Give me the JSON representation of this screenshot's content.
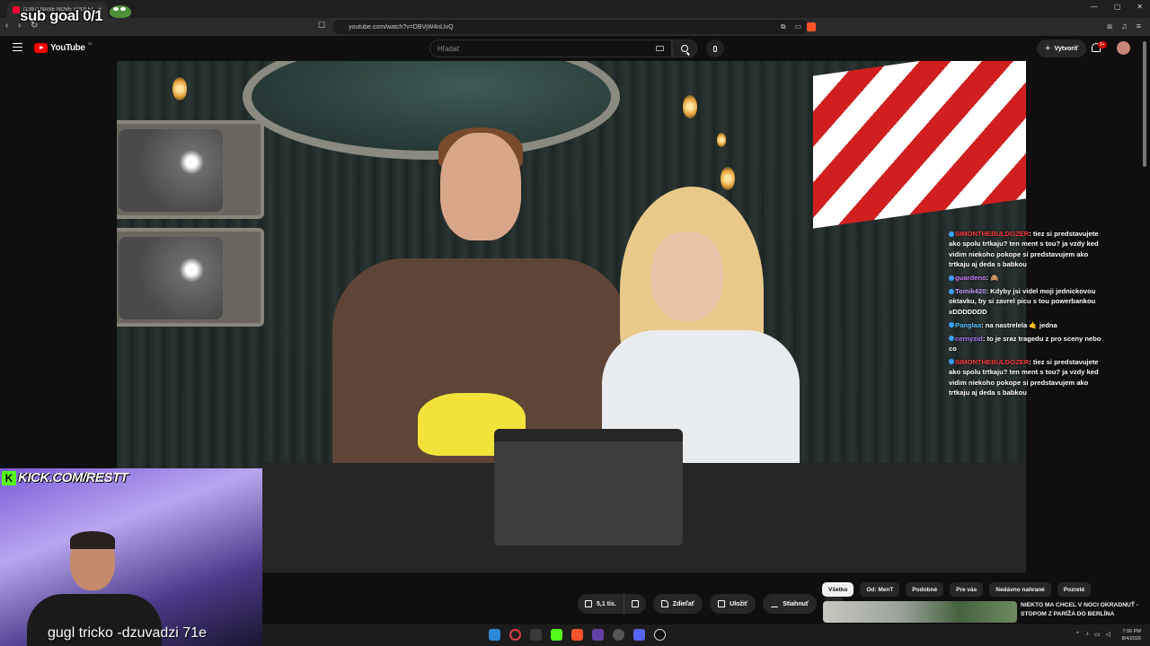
{
  "browser": {
    "tab_title": "(1397) NAŠE NOVÉ SPOLEČ",
    "url": "youtube.com/watch?v=DBVjW4nLlvQ"
  },
  "overlay": {
    "sub_goal": "sub goal 0/1",
    "kick_text": "KICK.COM/RESTT",
    "bottom_text": "gugl tricko -dzuvadzi 71e"
  },
  "youtube": {
    "logo_text": "YouTube",
    "country": "SK",
    "search_placeholder": "Hľadať",
    "create_label": "Vytvoriť",
    "notification_count": "9+"
  },
  "chat": [
    {
      "user": "SIMONTHEBULDOZER",
      "user_color": "#ff3b3b",
      "text": "tiez si predstavujete ako spolu trtkaju? ten ment s tou? ja vzdy ked vidim niekoho pokope si predstavujem ako trtkaju aj deda s babkou"
    },
    {
      "user": "guardeno",
      "user_color": "#d07bff",
      "text": "🙈"
    },
    {
      "user": "Tomik420",
      "user_color": "#c9a0ff",
      "text": "Kdyby jsi videl moji jednickovou oktavku, by si zavrel picu s tou powerbankou xDDDDDDD"
    },
    {
      "user": "Panglaa",
      "user_color": "#56c1ff",
      "text": "na nastrelela 🤙 jedna"
    },
    {
      "user": "cernyzid",
      "user_color": "#b07cff",
      "text": "to je sraz tragedu z pro sceny nebo co"
    },
    {
      "user": "SIMONTHEBULDOZER",
      "user_color": "#ff3b3b",
      "text": "tiez si predstavujete ako spolu trtkaju? ten ment s tou? ja vzdy ked vidim niekoho pokope si predstavujem ako trtkaju aj deda s babkou"
    }
  ],
  "actions": {
    "like_count": "5,1 tis.",
    "share": "Zdieľať",
    "save": "Uložiť",
    "download": "Stiahnuť"
  },
  "chips": [
    "Všetko",
    "Od: MenT",
    "Podobné",
    "Pre vás",
    "Nedávno nahrané",
    "Pozreté"
  ],
  "recommendation": {
    "title": "NIEKTO MA CHCEL V NOCI OKRADNUŤ - STOPOM Z PARÍŽA DO BERLÍNA"
  },
  "taskbar": {
    "time": "7:06 PM",
    "date": "8/4/2026"
  }
}
